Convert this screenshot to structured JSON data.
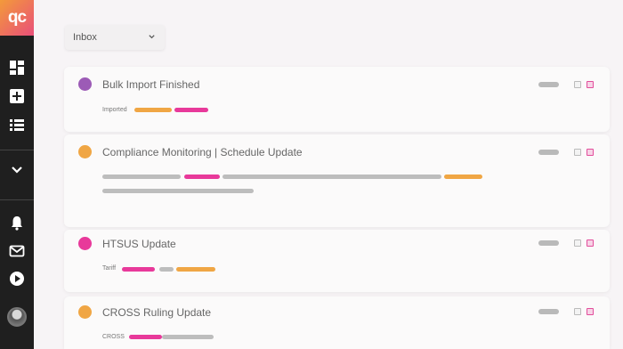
{
  "app": {
    "logo_text": "qc",
    "brand_gradient": [
      "#f39a3a",
      "#e94f7a"
    ]
  },
  "sidebar": {
    "icons": [
      "dashboard-icon",
      "add-icon",
      "list-icon",
      "chevron-down-icon",
      "bell-icon",
      "mail-icon",
      "play-icon",
      "avatar"
    ]
  },
  "filter": {
    "selected": "Inbox"
  },
  "colors": {
    "purple": "#9c5bb6",
    "orange": "#f0a644",
    "pink": "#e8399a",
    "gray": "#bdbdbd"
  },
  "notifications": [
    {
      "title": "Bulk Import Finished",
      "dot_color": "#9c5bb6",
      "tag_label": "Imported"
    },
    {
      "title": "Compliance Monitoring | Schedule Update",
      "dot_color": "#f0a644",
      "tag_label": ""
    },
    {
      "title": "HTSUS Update",
      "dot_color": "#e8399a",
      "tag_label": "Tariff"
    },
    {
      "title": "CROSS Ruling Update",
      "dot_color": "#f0a644",
      "tag_label": "CROSS"
    }
  ]
}
